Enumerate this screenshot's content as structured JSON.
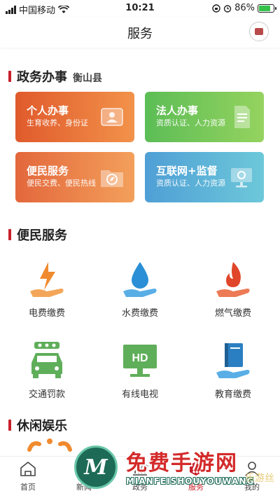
{
  "status_bar": {
    "carrier": "中国移动",
    "time": "10:21",
    "battery_percent": "86%",
    "battery_level": 0.86,
    "battery_color": "#35c24a"
  },
  "header": {
    "title": "服务"
  },
  "gov_section": {
    "title": "政务办事",
    "region": "衡山县",
    "cards": [
      {
        "title": "个人办事",
        "desc": "生育收养、身份证",
        "icon": "id-card-icon"
      },
      {
        "title": "法人办事",
        "desc": "资质认证、人力资源",
        "icon": "document-icon"
      },
      {
        "title": "便民服务",
        "desc": "便民交费、便民热线",
        "icon": "folder-compass-icon"
      },
      {
        "title": "互联网+监督",
        "desc": "资质认证、人力资源",
        "icon": "monitor-icon"
      }
    ]
  },
  "convenience_section": {
    "title": "便民服务",
    "items": [
      {
        "label": "电费缴费",
        "icon": "lightning-hand-icon"
      },
      {
        "label": "水费缴费",
        "icon": "water-drop-hand-icon"
      },
      {
        "label": "燃气缴费",
        "icon": "flame-hand-icon"
      },
      {
        "label": "交通罚款",
        "icon": "car-icon"
      },
      {
        "label": "有线电视",
        "icon": "hd-tv-icon"
      },
      {
        "label": "教育缴费",
        "icon": "book-hand-icon"
      }
    ]
  },
  "leisure_section": {
    "title": "休闲娱乐"
  },
  "tabbar": {
    "tabs": [
      {
        "label": "首页",
        "icon": "home-icon"
      },
      {
        "label": "新闻",
        "icon": "news-icon"
      },
      {
        "label": "政务",
        "icon": "gov-icon"
      },
      {
        "label": "服务",
        "icon": "service-icon"
      },
      {
        "label": "我的",
        "icon": "profile-icon"
      }
    ],
    "active_index": 3,
    "active_color": "#c8202b"
  },
  "watermark": {
    "title": "免费手游网",
    "subtitle": "MIANFEISHOUYOUWANG",
    "logo_letter": "M",
    "faint_text": "乐游丝"
  },
  "colors": {
    "accent": "#c8202b",
    "orange_icon": "#f08a2e",
    "blue_icon": "#2a8fd6",
    "red_icon": "#e0462a",
    "green_icon": "#5fae5a"
  }
}
